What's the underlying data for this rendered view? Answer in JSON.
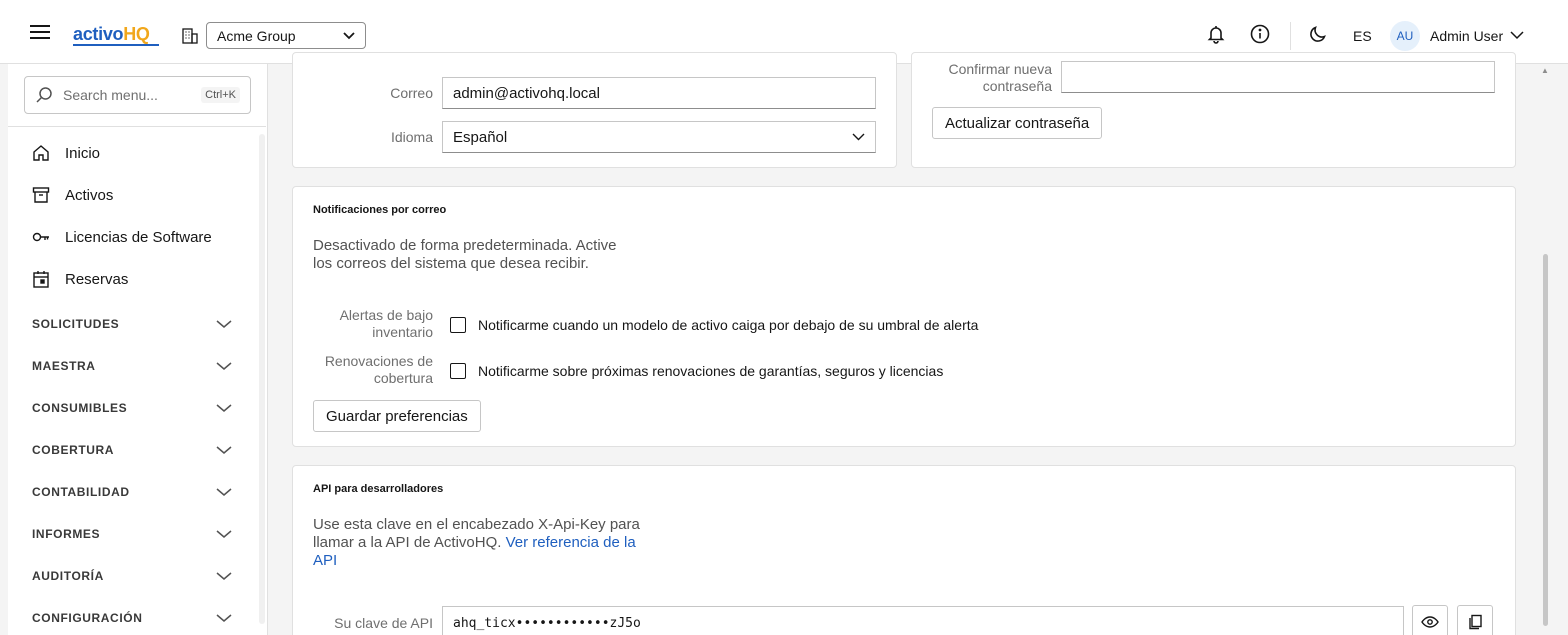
{
  "header": {
    "logo_part1": "activo",
    "logo_part2": "HQ",
    "org_select": "Acme Group",
    "lang": "ES",
    "avatar": "AU",
    "user_name": "Admin User"
  },
  "sidebar": {
    "search_placeholder": "Search menu...",
    "search_shortcut": "Ctrl+K",
    "items": [
      {
        "label": "Inicio",
        "icon": "home-icon"
      },
      {
        "label": "Activos",
        "icon": "archive-icon"
      },
      {
        "label": "Licencias de Software",
        "icon": "key-icon"
      },
      {
        "label": "Reservas",
        "icon": "calendar-icon"
      }
    ],
    "sections": [
      "SOLICITUDES",
      "MAESTRA",
      "CONSUMIBLES",
      "COBERTURA",
      "CONTABILIDAD",
      "INFORMES",
      "AUDITORÍA",
      "CONFIGURACIÓN"
    ]
  },
  "profile": {
    "email_label": "Correo",
    "email_value": "admin@activohq.local",
    "language_label": "Idioma",
    "language_value": "Español"
  },
  "password": {
    "confirm_label_1": "Confirmar nueva",
    "confirm_label_2": "contraseña",
    "update_button": "Actualizar contraseña"
  },
  "notifications": {
    "title": "Notificaciones por correo",
    "desc_1": "Desactivado de forma predeterminada. Active",
    "desc_2": "los correos del sistema que desea recibir.",
    "low_stock_label_1": "Alertas de bajo",
    "low_stock_label_2": "inventario",
    "low_stock_text": "Notificarme cuando un modelo de activo caiga por debajo de su umbral de alerta",
    "renewals_label_1": "Renovaciones de",
    "renewals_label_2": "cobertura",
    "renewals_text": "Notificarme sobre próximas renovaciones de garantías, seguros y licencias",
    "save_button": "Guardar preferencias"
  },
  "api": {
    "title": "API para desarrolladores",
    "desc_1": "Use esta clave en el encabezado X-Api-Key para",
    "desc_2": "llamar a la API de ActivoHQ.",
    "link_1": "Ver referencia de la",
    "link_2": "API",
    "key_label": "Su clave de API",
    "key_value": "ahq_ticx••••••••••••zJ5o"
  }
}
